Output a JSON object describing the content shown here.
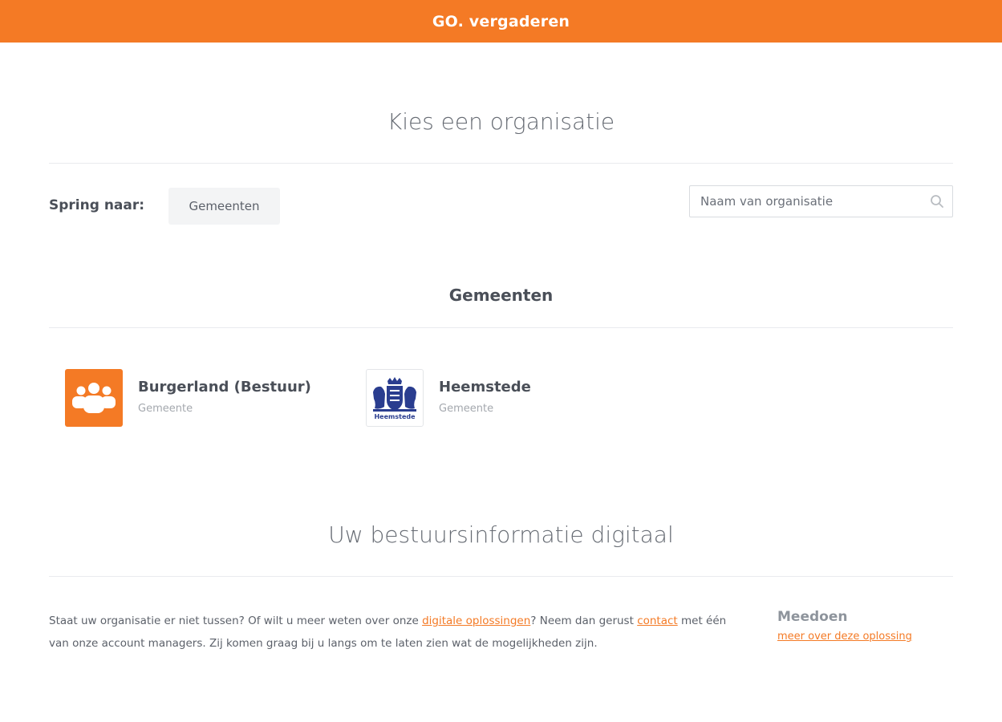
{
  "header": {
    "brand": "GO. vergaderen",
    "color": "#f47a25"
  },
  "page": {
    "title": "Kies een organisatie"
  },
  "jump": {
    "label": "Spring naar:",
    "button": "Gemeenten"
  },
  "search": {
    "placeholder": "Naam van organisatie",
    "value": ""
  },
  "section": {
    "title": "Gemeenten"
  },
  "organisations": [
    {
      "name": "Burgerland (Bestuur)",
      "type": "Gemeente",
      "logo": "group-icon"
    },
    {
      "name": "Heemstede",
      "type": "Gemeente",
      "logo": "coat-of-arms",
      "logo_text": "Heemstede"
    }
  ],
  "footer": {
    "title": "Uw bestuursinformatie digitaal",
    "text_1": "Staat uw organisatie er niet tussen? Of wilt u meer weten over onze ",
    "link_1": "digitale oplossingen",
    "text_2": "? Neem dan gerust ",
    "link_2": "contact",
    "text_3": " met één van onze account managers. Zij komen graag bij u langs om te laten zien wat de mogelijkheden zijn.",
    "join_title": "Meedoen",
    "join_link": "meer over deze oplossing"
  }
}
